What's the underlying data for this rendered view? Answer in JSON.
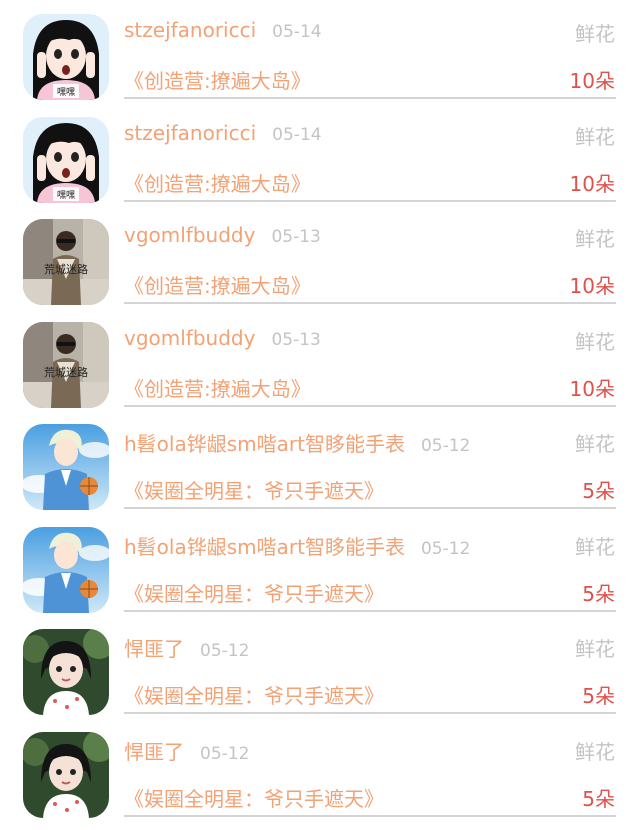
{
  "records": [
    {
      "avatar_icon": "manga-girl-avatar-icon",
      "username": "stzejfanoricci",
      "date": "05-14",
      "gift_type": "鲜花",
      "book": "《创造营:撩遍大岛》",
      "amount": "10朵"
    },
    {
      "avatar_icon": "manga-girl-avatar-icon",
      "username": "stzejfanoricci",
      "date": "05-14",
      "gift_type": "鲜花",
      "book": "《创造营:撩遍大岛》",
      "amount": "10朵"
    },
    {
      "avatar_icon": "street-photo-avatar-icon",
      "username": "vgomlfbuddy",
      "date": "05-13",
      "gift_type": "鲜花",
      "book": "《创造营:撩遍大岛》",
      "amount": "10朵"
    },
    {
      "avatar_icon": "street-photo-avatar-icon",
      "username": "vgomlfbuddy",
      "date": "05-13",
      "gift_type": "鲜花",
      "book": "《创造营:撩遍大岛》",
      "amount": "10朵"
    },
    {
      "avatar_icon": "anime-boy-avatar-icon",
      "username": "h髫ola铧龈sm喈art智眵能手表",
      "date": "05-12",
      "gift_type": "鲜花",
      "book": "《娱圈全明星：爷只手遮天》",
      "amount": "5朵"
    },
    {
      "avatar_icon": "anime-boy-avatar-icon",
      "username": "h髫ola铧龈sm喈art智眵能手表",
      "date": "05-12",
      "gift_type": "鲜花",
      "book": "《娱圈全明星：爷只手遮天》",
      "amount": "5朵"
    },
    {
      "avatar_icon": "little-girl-avatar-icon",
      "username": "悍匪了",
      "date": "05-12",
      "gift_type": "鲜花",
      "book": "《娱圈全明星：爷只手遮天》",
      "amount": "5朵"
    },
    {
      "avatar_icon": "little-girl-avatar-icon",
      "username": "悍匪了",
      "date": "05-12",
      "gift_type": "鲜花",
      "book": "《娱圈全明星：爷只手遮天》",
      "amount": "5朵"
    }
  ],
  "avatar_texts": {
    "manga_caption": "嘿嘿",
    "street_caption": "荒城迷路"
  },
  "colors": {
    "username": "#f2a274",
    "book_title": "#f2a274",
    "amount": "#e0504c",
    "muted": "#c4c4c4",
    "divider": "#d4d4d4"
  }
}
